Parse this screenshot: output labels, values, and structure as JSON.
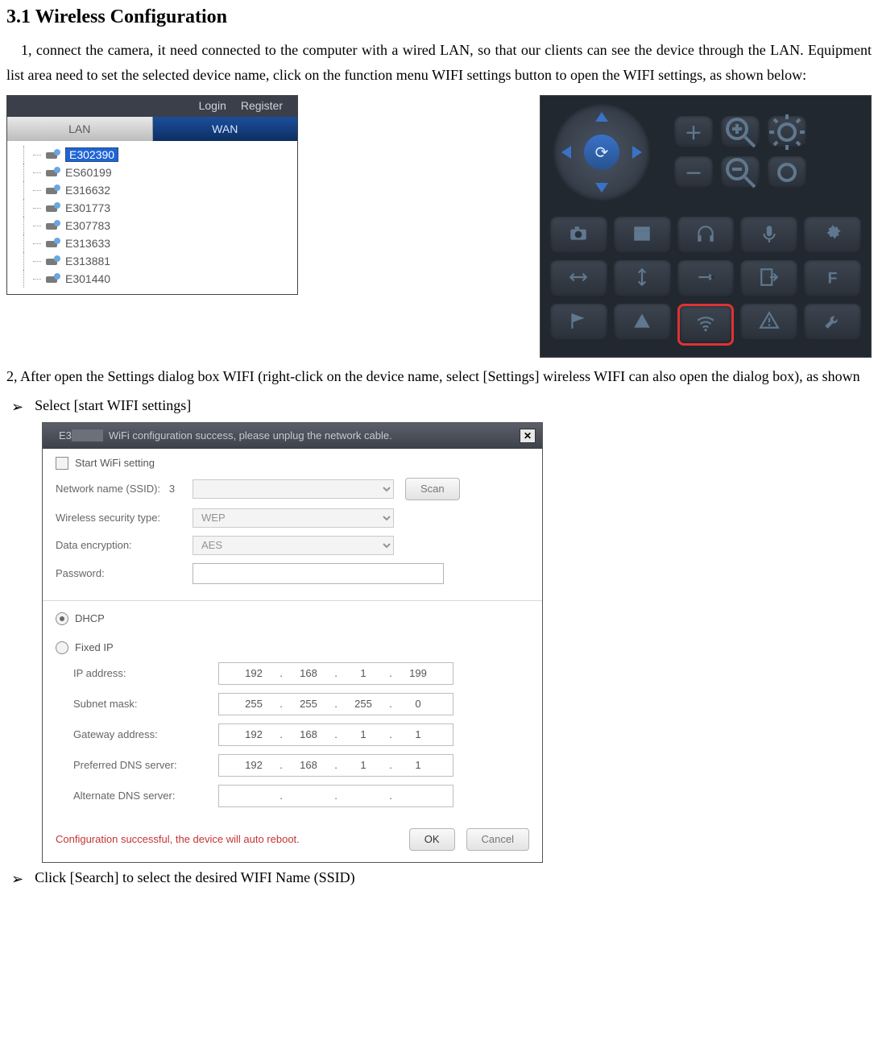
{
  "heading": "3.1 Wireless Configuration",
  "para1": "1, connect the camera, it need connected to the computer with a wired LAN, so that our clients can see the device through the LAN. Equipment list area need to set the selected device name, click on the function menu WIFI settings button to open the WIFI settings, as shown below:",
  "para2": "2, After open the Settings dialog box WIFI (right-click on the device name, select [Settings] wireless WIFI can also open the dialog box), as shown",
  "bullet1": "Select [start WIFI settings]",
  "bullet2": "Click [Search] to select the desired WIFI Name (SSID)",
  "panel_list": {
    "login": "Login",
    "register": "Register",
    "tab_lan": "LAN",
    "tab_wan": "WAN",
    "devices": [
      "E302390",
      "ES60199",
      "E316632",
      "E301773",
      "E307783",
      "E313633",
      "E313881",
      "E301440"
    ],
    "selected_index": 0
  },
  "panel_grid": {
    "icons": [
      "camera-icon",
      "clapper-icon",
      "headphones-icon",
      "mic-icon",
      "gear-icon",
      "arrow-left-right-icon",
      "arrow-up-down-icon",
      "arrow-target-icon",
      "exit-icon",
      "letter-f-icon",
      "flag-icon",
      "pyramid-icon",
      "wifi-icon",
      "warning-icon",
      "wrench-icon"
    ],
    "highlighted_index": 12
  },
  "dialog": {
    "title_prefix": "E3",
    "title_rest": "WiFi configuration success, please unplug the network cable.",
    "start_wifi": "Start WiFi setting",
    "ssid_label": "Network name (SSID):",
    "ssid_count": "3",
    "scan": "Scan",
    "sec_label": "Wireless security type:",
    "sec_value": "WEP",
    "enc_label": "Data encryption:",
    "enc_value": "AES",
    "pwd_label": "Password:",
    "dhcp": "DHCP",
    "fixed": "Fixed IP",
    "ip_label": "IP address:",
    "ip": [
      "192",
      "168",
      "1",
      "199"
    ],
    "mask_label": "Subnet mask:",
    "mask": [
      "255",
      "255",
      "255",
      "0"
    ],
    "gw_label": "Gateway address:",
    "gw": [
      "192",
      "168",
      "1",
      "1"
    ],
    "dns1_label": "Preferred DNS server:",
    "dns1": [
      "192",
      "168",
      "1",
      "1"
    ],
    "dns2_label": "Alternate DNS server:",
    "dns2": [
      "",
      "",
      "",
      ""
    ],
    "footer_msg": "Configuration successful, the device will auto reboot.",
    "ok": "OK",
    "cancel": "Cancel"
  }
}
